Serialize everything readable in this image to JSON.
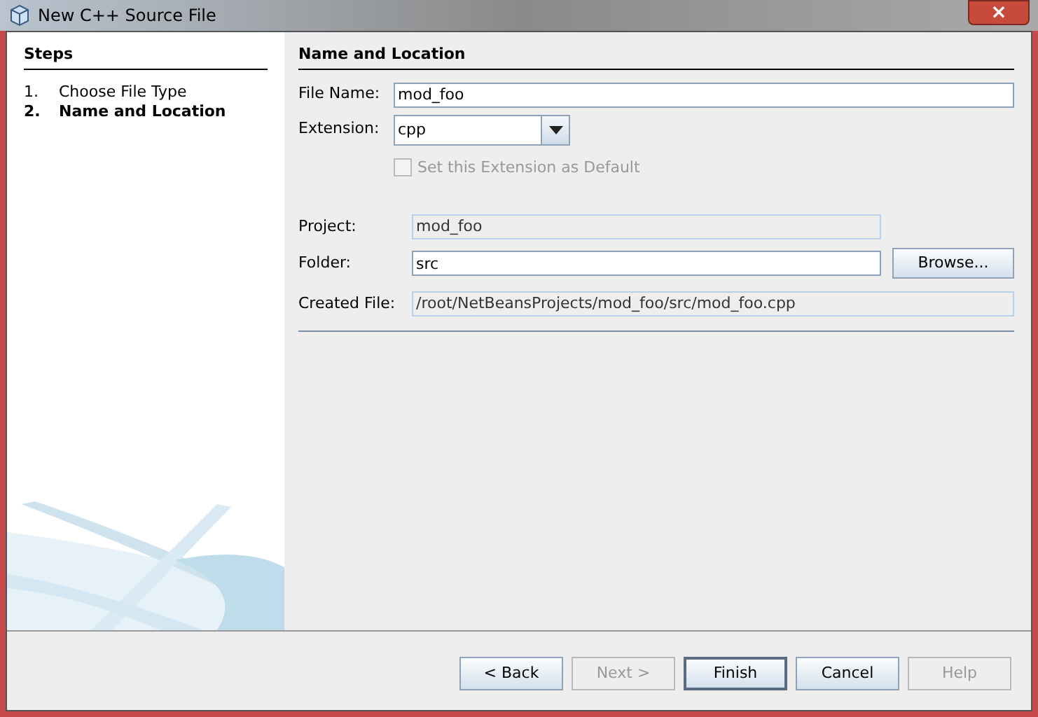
{
  "window": {
    "title": "New C++ Source File",
    "close": "×"
  },
  "steps": {
    "title": "Steps",
    "items": [
      {
        "number": "1.",
        "label": "Choose File Type",
        "selected": false
      },
      {
        "number": "2.",
        "label": "Name and Location",
        "selected": true
      }
    ]
  },
  "panel": {
    "title": "Name and Location",
    "file_name": {
      "label": "File Name:",
      "value": "mod_foo"
    },
    "extension": {
      "label": "Extension:",
      "value": "cpp"
    },
    "default_checkbox": {
      "label": "Set this Extension as Default",
      "checked": false,
      "disabled": true
    },
    "project": {
      "label": "Project:",
      "value": "mod_foo"
    },
    "folder": {
      "label": "Folder:",
      "value": "src",
      "button": "Browse..."
    },
    "created_file": {
      "label": "Created File:",
      "value": "/root/NetBeansProjects/mod_foo/src/mod_foo.cpp"
    }
  },
  "buttons": [
    {
      "label": "< Back",
      "disabled": false,
      "selected": false
    },
    {
      "label": "Next >",
      "disabled": true,
      "selected": false
    },
    {
      "label": "Finish",
      "disabled": false,
      "selected": true
    },
    {
      "label": "Cancel",
      "disabled": false,
      "selected": false
    },
    {
      "label": "Help",
      "disabled": true,
      "selected": false
    }
  ]
}
